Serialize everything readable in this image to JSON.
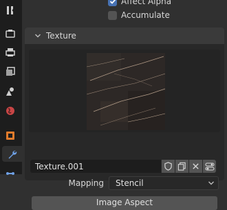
{
  "properties": {
    "affect_alpha": {
      "label": "Affect Alpha",
      "checked": true
    },
    "accumulate": {
      "label": "Accumulate",
      "checked": false
    }
  },
  "texture_panel": {
    "title": "Texture",
    "expanded": true,
    "texture_name": "Texture.001",
    "icons": [
      "shield-icon",
      "duplicate-icon",
      "close-icon",
      "settings-toggle-icon"
    ],
    "mapping": {
      "label": "Mapping",
      "value": "Stencil"
    },
    "bottom_button": "Image Aspect"
  },
  "colors": {
    "accent": "#4772b3",
    "background": "#303030",
    "panel": "#282828",
    "sidebar": "#1d1d1d"
  }
}
